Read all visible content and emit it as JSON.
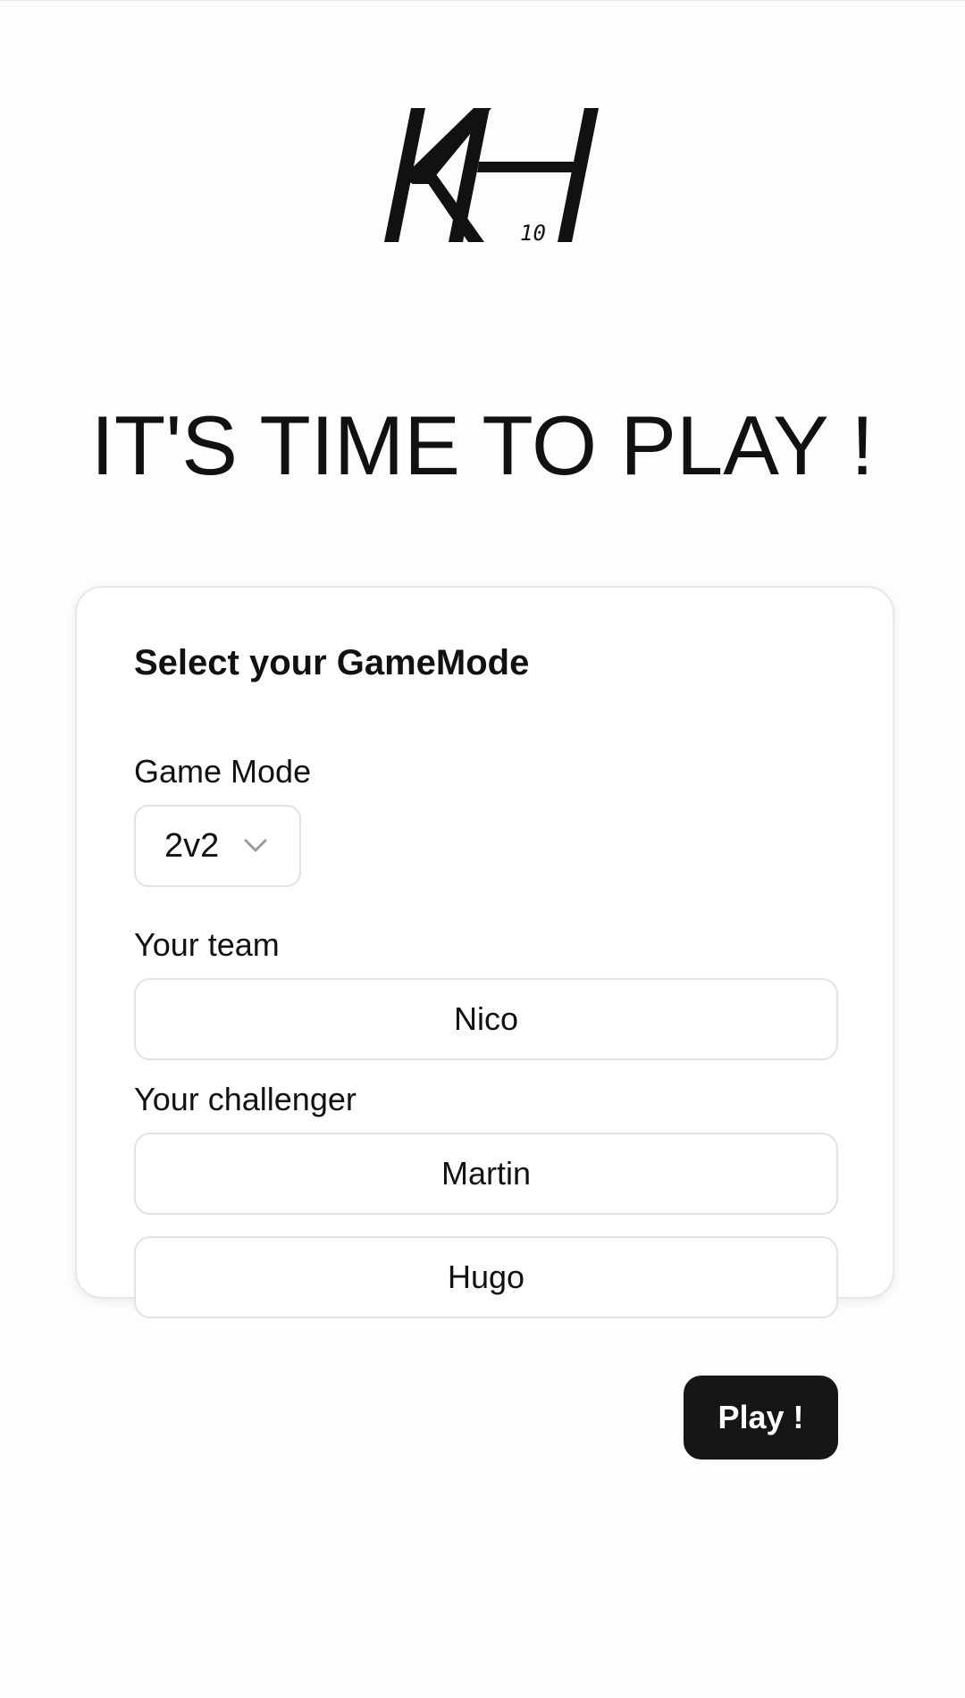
{
  "logo": {
    "text": "KH",
    "badge": "10",
    "icon": "kh-logo-icon"
  },
  "headline": "IT'S TIME TO PLAY !",
  "form": {
    "title": "Select your GameMode",
    "game_mode": {
      "label": "Game Mode",
      "selected": "2v2",
      "icon": "chevron-down-icon"
    },
    "team": {
      "label": "Your team",
      "players": [
        "Nico"
      ]
    },
    "challenger": {
      "label": "Your challenger",
      "players": [
        "Martin",
        "Hugo"
      ]
    },
    "submit_label": "Play !"
  },
  "colors": {
    "background": "#fdfdfd",
    "card": "#ffffff",
    "border": "#e2e2e2",
    "button": "#161616",
    "button_text": "#ffffff",
    "text": "#111111"
  }
}
